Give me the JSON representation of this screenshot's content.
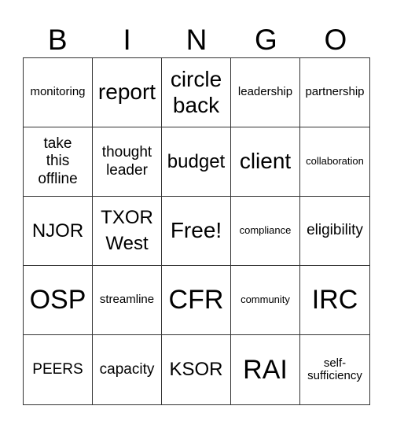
{
  "header": {
    "letters": [
      "B",
      "I",
      "N",
      "G",
      "O"
    ]
  },
  "board": {
    "rows": [
      [
        "monitoring",
        "report",
        "circle back",
        "leadership",
        "partnership"
      ],
      [
        "take this offline",
        "thought leader",
        "budget",
        "client",
        "collaboration"
      ],
      [
        "NJOR",
        "TXOR West",
        "Free!",
        "compliance",
        "eligibility"
      ],
      [
        "OSP",
        "streamline",
        "CFR",
        "community",
        "IRC"
      ],
      [
        "PEERS",
        "capacity",
        "KSOR",
        "RAI",
        "self-sufficiency"
      ]
    ],
    "free_space_label": "Free!"
  }
}
